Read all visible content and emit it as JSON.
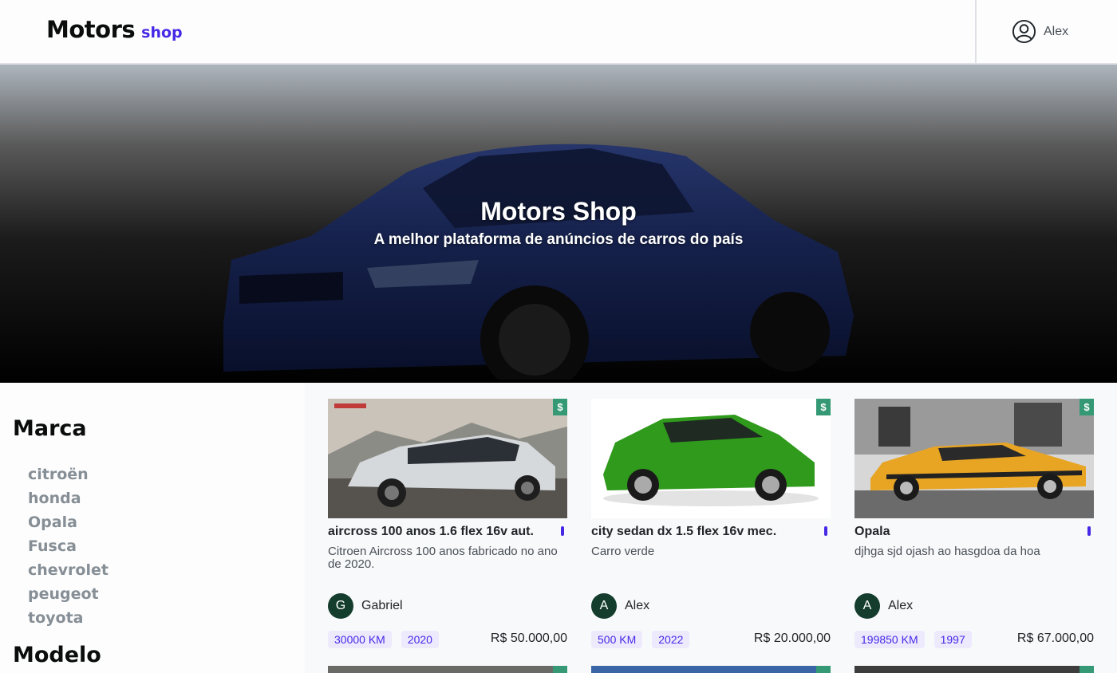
{
  "header": {
    "logo_main": "Motors",
    "logo_sub": "shop",
    "user_name": "Alex"
  },
  "hero": {
    "title": "Motors Shop",
    "subtitle": "A melhor plataforma de anúncios de carros do país"
  },
  "sidebar": {
    "brand_title": "Marca",
    "brands": [
      "citroën",
      "honda",
      "Opala",
      "Fusca",
      "chevrolet",
      "peugeot",
      "toyota"
    ],
    "model_title": "Modelo"
  },
  "cards": [
    {
      "badge": "$",
      "title": "aircross 100 anos 1.6 flex 16v aut.",
      "description": "Citroen Aircross 100 anos fabricado no ano de 2020.",
      "seller_initial": "G",
      "seller": "Gabriel",
      "km": "30000 KM",
      "year": "2020",
      "price": "R$ 50.000,00",
      "image": "silver-suv"
    },
    {
      "badge": "$",
      "title": "city sedan dx 1.5 flex 16v mec.",
      "description": "Carro verde",
      "seller_initial": "A",
      "seller": "Alex",
      "km": "500 KM",
      "year": "2022",
      "price": "R$ 20.000,00",
      "image": "green-hatchback"
    },
    {
      "badge": "$",
      "title": "Opala",
      "description": "djhga sjd ojash ao hasgdoa da hoa",
      "seller_initial": "A",
      "seller": "Alex",
      "km": "199850 KM",
      "year": "1997",
      "price": "R$ 67.000,00",
      "image": "orange-classic"
    }
  ],
  "colors": {
    "brand": "#4529e6",
    "badge_green": "#349974",
    "avatar": "#153d2e"
  }
}
